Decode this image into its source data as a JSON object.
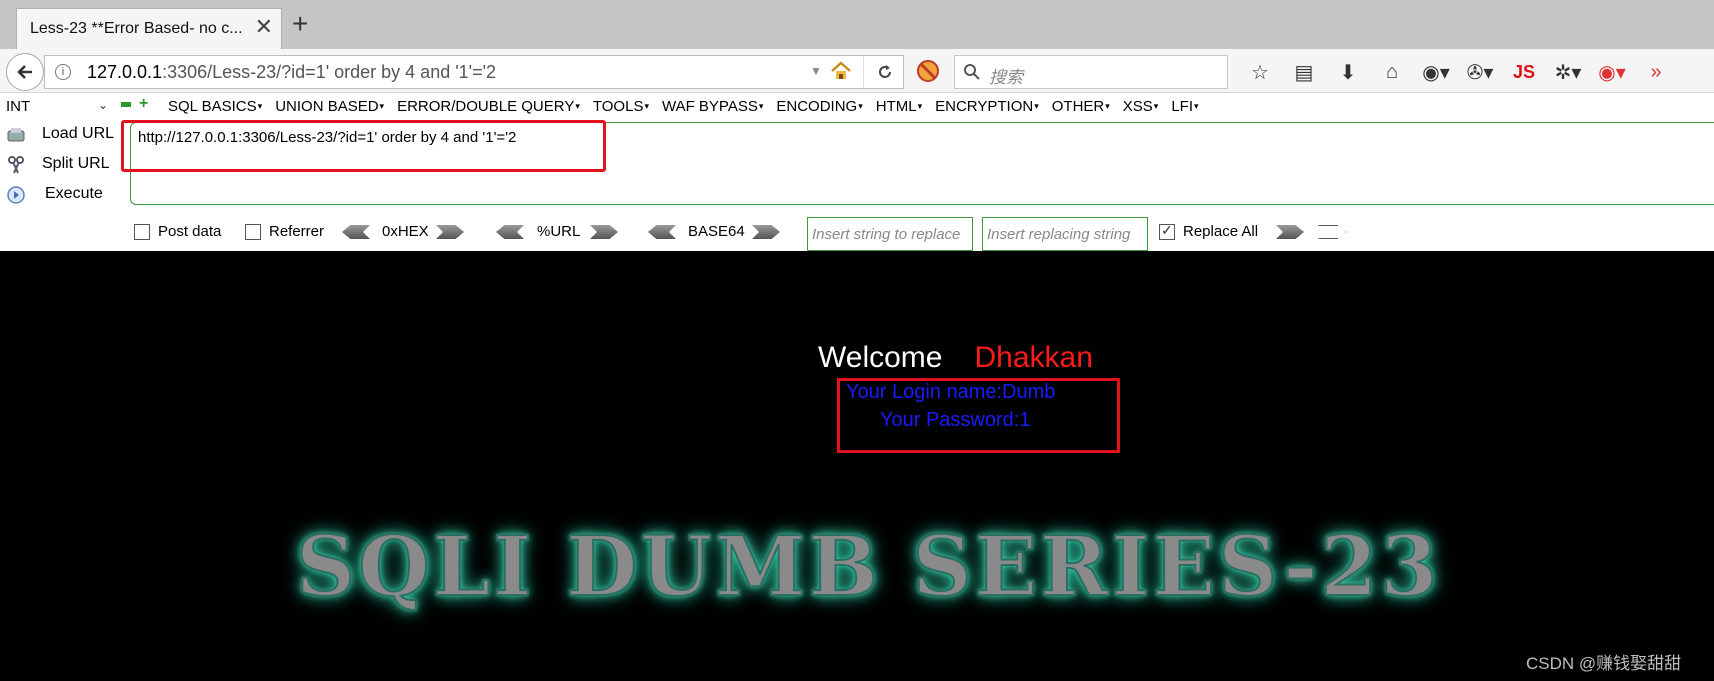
{
  "tab": {
    "title": "Less-23 **Error Based- no c...",
    "close": "✕",
    "new": "+"
  },
  "nav": {
    "url_host": "127.0.0.1",
    "url_path": ":3306/Less-23/?id=1' order by 4 and '1'='2",
    "search_placeholder": "搜索",
    "js_label": "JS"
  },
  "hackbar": {
    "select_value": "INT",
    "menus": [
      "SQL BASICS",
      "UNION BASED",
      "ERROR/DOUBLE QUERY",
      "TOOLS",
      "WAF BYPASS",
      "ENCODING",
      "HTML",
      "ENCRYPTION",
      "OTHER",
      "XSS",
      "LFI"
    ],
    "load_url": "Load URL",
    "split_url": "Split URL",
    "execute": "Execute",
    "url_value": "http://127.0.0.1:3306/Less-23/?id=1' order by 4 and '1'='2",
    "post_data": "Post data",
    "referrer": "Referrer",
    "hex": "0xHEX",
    "url_enc": "%URL",
    "base64": "BASE64",
    "insert_replace_ph": "Insert string to replace",
    "insert_replacing_ph": "Insert replacing string",
    "replace_all": "Replace All",
    "post_data_checked": false,
    "referrer_checked": false,
    "replace_all_checked": true
  },
  "page": {
    "welcome": "Welcome",
    "name": "Dhakkan",
    "login": "Your Login name:Dumb",
    "password": "Your Password:1",
    "banner": "SQLI DUMB SERIES-23",
    "watermark": "CSDN @赚钱娶甜甜"
  },
  "colors": {
    "accent_red": "#e3101e",
    "hackbar_green": "#3a9a3a",
    "login_blue": "#1a1aff",
    "banner_glow": "#3fd9b6"
  }
}
